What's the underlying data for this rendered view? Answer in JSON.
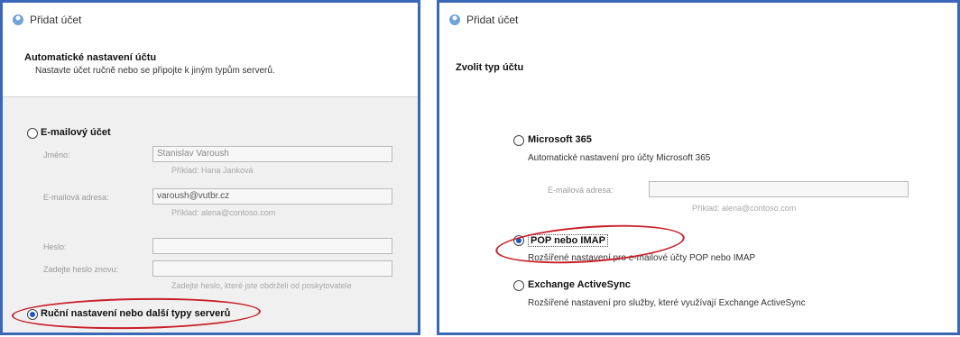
{
  "left_dialog": {
    "title": "Přidat účet",
    "heading": "Automatické nastavení účtu",
    "subheading": "Nastavte účet ručně nebo se připojte k jiným typům serverů.",
    "email_account": {
      "label": "E-mailový účet",
      "selected": false,
      "fields": [
        {
          "label": "Jméno:",
          "value": "Stanislav Varoush",
          "hint": "Příklad: Hana Janková"
        },
        {
          "label": "E-mailová adresa:",
          "value": "varoush@vutbr.cz",
          "hint": "Příklad: alena@contoso.com"
        },
        {
          "label": "Heslo:",
          "value": "",
          "hint": ""
        },
        {
          "label": "Zadejte heslo znovu:",
          "value": "",
          "hint": "Zadejte heslo, které jste obdrželi od poskytovatele"
        }
      ]
    },
    "manual_option": {
      "label": "Ruční nastavení nebo další typy serverů",
      "selected": true
    }
  },
  "right_dialog": {
    "title": "Přidat účet",
    "heading": "Zvolit typ účtu",
    "options": [
      {
        "label": "Microsoft 365",
        "description": "Automatické nastavení pro účty Microsoft 365",
        "selected": false
      },
      {
        "label": "POP nebo IMAP",
        "description": "Rozšířené nastavení pro e-mailové účty POP nebo IMAP",
        "selected": true
      },
      {
        "label": "Exchange ActiveSync",
        "description": "Rozšířené nastavení pro služby, které využívají Exchange ActiveSync",
        "selected": false
      }
    ],
    "email_field": {
      "label": "E-mailová adresa:",
      "value": "",
      "hint": "Příklad: alena@contoso.com"
    }
  },
  "colors": {
    "panel_border": "#3a67b8",
    "highlight_circle": "#c8202a",
    "radio_dot": "#1a56c4"
  }
}
